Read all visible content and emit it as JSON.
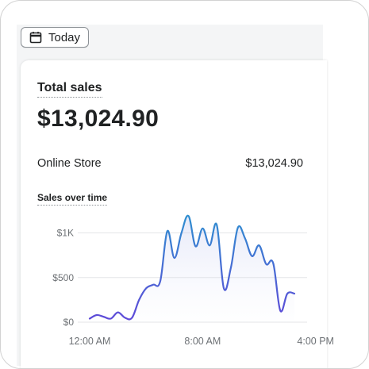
{
  "toolbar": {
    "date_button_label": "Today",
    "date_button_icon": "calendar-icon"
  },
  "card": {
    "title": "Total sales",
    "total_value": "$13,024.90",
    "breakdown": [
      {
        "label": "Online Store",
        "value": "$13,024.90"
      }
    ],
    "sales_over_time_label": "Sales over time"
  },
  "chart_data": {
    "type": "line",
    "title": "Sales over time",
    "xlabel": "",
    "ylabel": "",
    "ylim": [
      0,
      1200
    ],
    "y_ticks": [
      {
        "value": 0,
        "label": "$0"
      },
      {
        "value": 500,
        "label": "$500"
      },
      {
        "value": 1000,
        "label": "$1K"
      }
    ],
    "x_ticks": [
      {
        "hour": 0,
        "label": "12:00 AM"
      },
      {
        "hour": 8,
        "label": "8:00 AM"
      },
      {
        "hour": 16,
        "label": "4:00 PM"
      }
    ],
    "grid": true,
    "series": [
      {
        "color_start": "#2f8fd0",
        "color_end": "#5e4ad8",
        "points": [
          [
            0,
            40
          ],
          [
            0.5,
            80
          ],
          [
            1,
            60
          ],
          [
            1.5,
            40
          ],
          [
            2,
            110
          ],
          [
            2.5,
            50
          ],
          [
            3,
            50
          ],
          [
            3.5,
            250
          ],
          [
            4,
            380
          ],
          [
            4.5,
            420
          ],
          [
            5,
            460
          ],
          [
            5.5,
            1020
          ],
          [
            6,
            720
          ],
          [
            6.5,
            1000
          ],
          [
            7,
            1190
          ],
          [
            7.5,
            850
          ],
          [
            8,
            1050
          ],
          [
            8.5,
            860
          ],
          [
            9,
            1090
          ],
          [
            9.5,
            380
          ],
          [
            10,
            610
          ],
          [
            10.5,
            1060
          ],
          [
            11,
            940
          ],
          [
            11.5,
            740
          ],
          [
            12,
            860
          ],
          [
            12.5,
            650
          ],
          [
            13,
            660
          ],
          [
            13.5,
            130
          ],
          [
            14,
            320
          ],
          [
            14.5,
            320
          ]
        ]
      }
    ]
  }
}
